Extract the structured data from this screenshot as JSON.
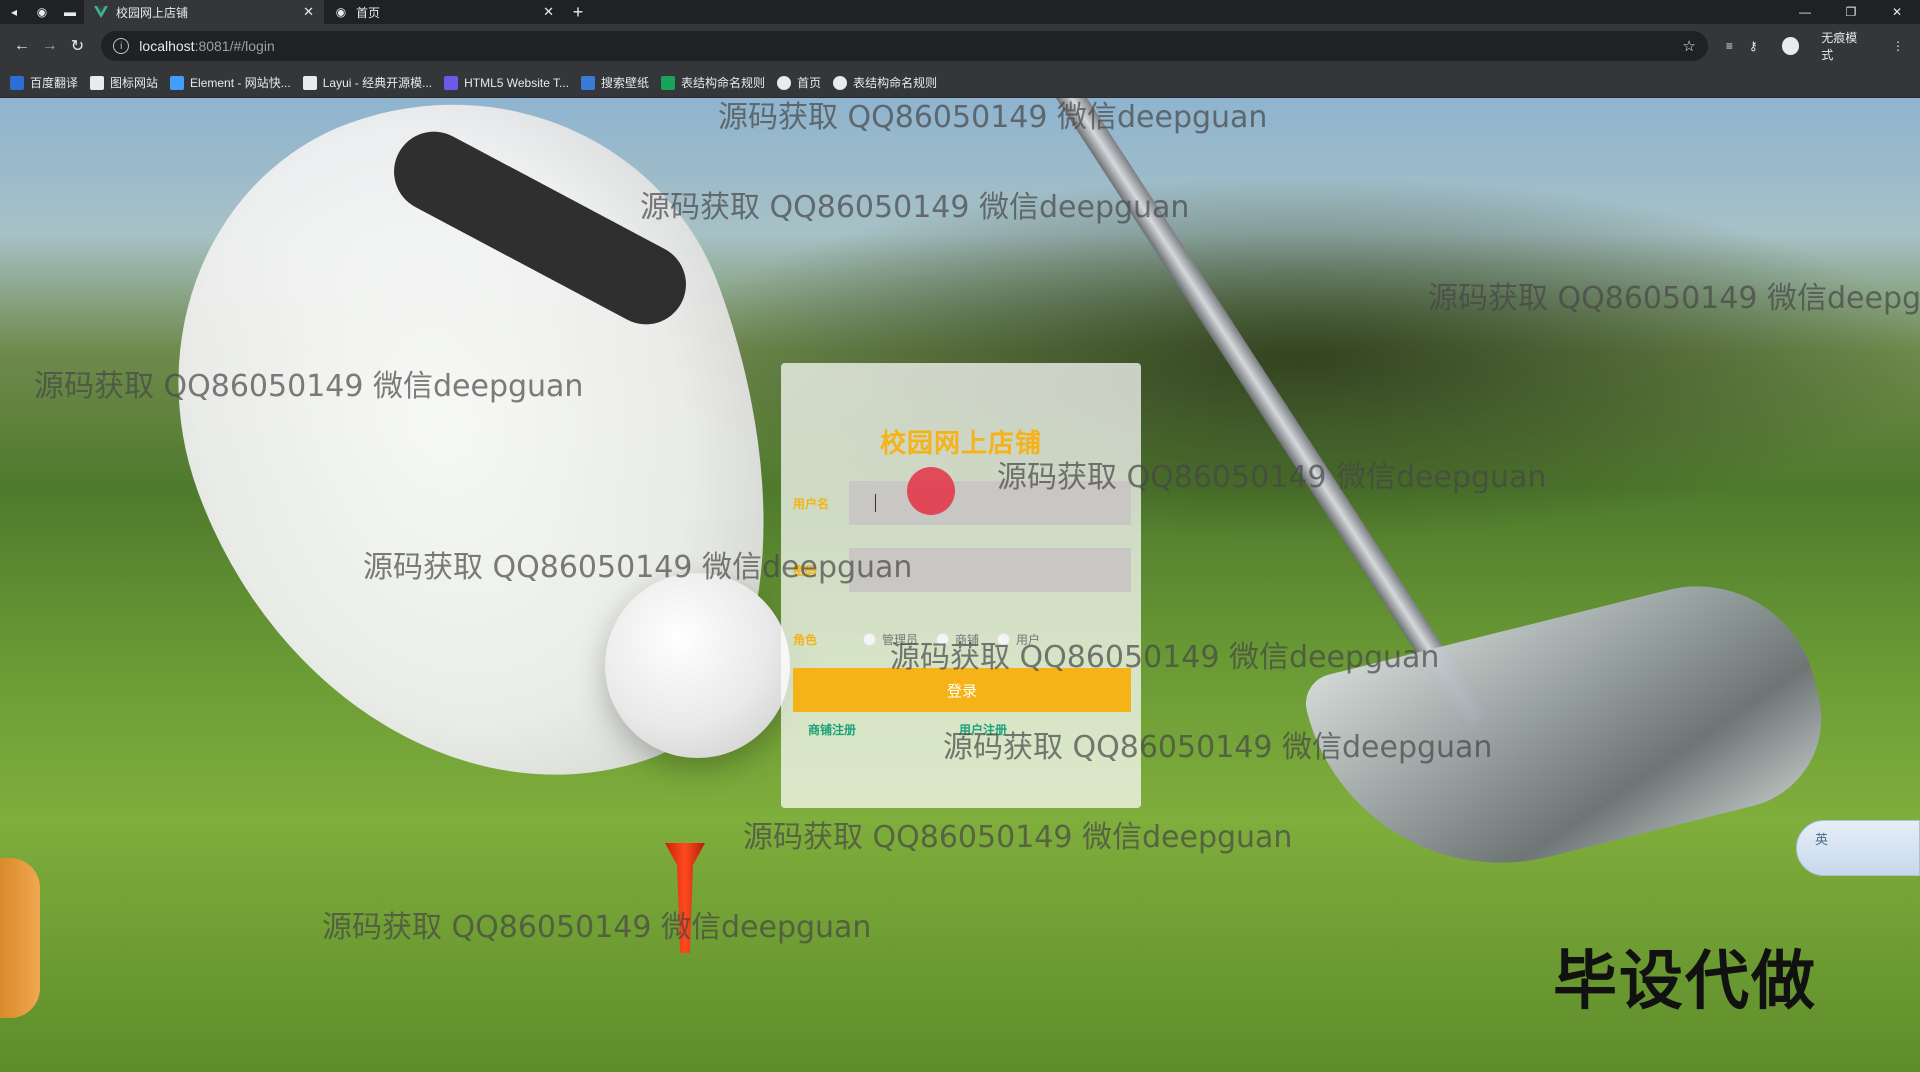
{
  "browser": {
    "tabs": [
      {
        "title": "校园网上店铺",
        "active": true
      },
      {
        "title": "首页",
        "active": false
      }
    ],
    "address": {
      "host": "localhost",
      "path": ":8081/#/login"
    },
    "incognito_label": "无痕模式",
    "bookmarks": [
      {
        "label": "百度翻译",
        "color": "#2b6fd6"
      },
      {
        "label": "图标网站",
        "color": "#e8eaed"
      },
      {
        "label": "Element - 网站快...",
        "color": "#409eff"
      },
      {
        "label": "Layui - 经典开源模...",
        "color": "#e8eaed"
      },
      {
        "label": "HTML5 Website T...",
        "color": "#6b5ce7"
      },
      {
        "label": "搜索壁纸",
        "color": "#3b7bd8"
      },
      {
        "label": "表结构命名规则",
        "color": "#1aa35a"
      },
      {
        "label": "首页",
        "color": "#e8eaed"
      },
      {
        "label": "表结构命名规则",
        "color": "#e8eaed"
      }
    ]
  },
  "login": {
    "title": "校园网上店铺",
    "username_label": "用户名",
    "password_label": "密码",
    "role_label": "角色",
    "roles": [
      "管理员",
      "商铺",
      "用户"
    ],
    "submit_label": "登录",
    "shop_register": "商铺注册",
    "user_register": "用户注册"
  },
  "overlay": {
    "watermark": "源码获取 QQ86050149 微信deepguan",
    "corner_text": "毕设代做",
    "ime_label": "英"
  },
  "colors": {
    "accent": "#f5b318",
    "link": "#1aa37a"
  }
}
